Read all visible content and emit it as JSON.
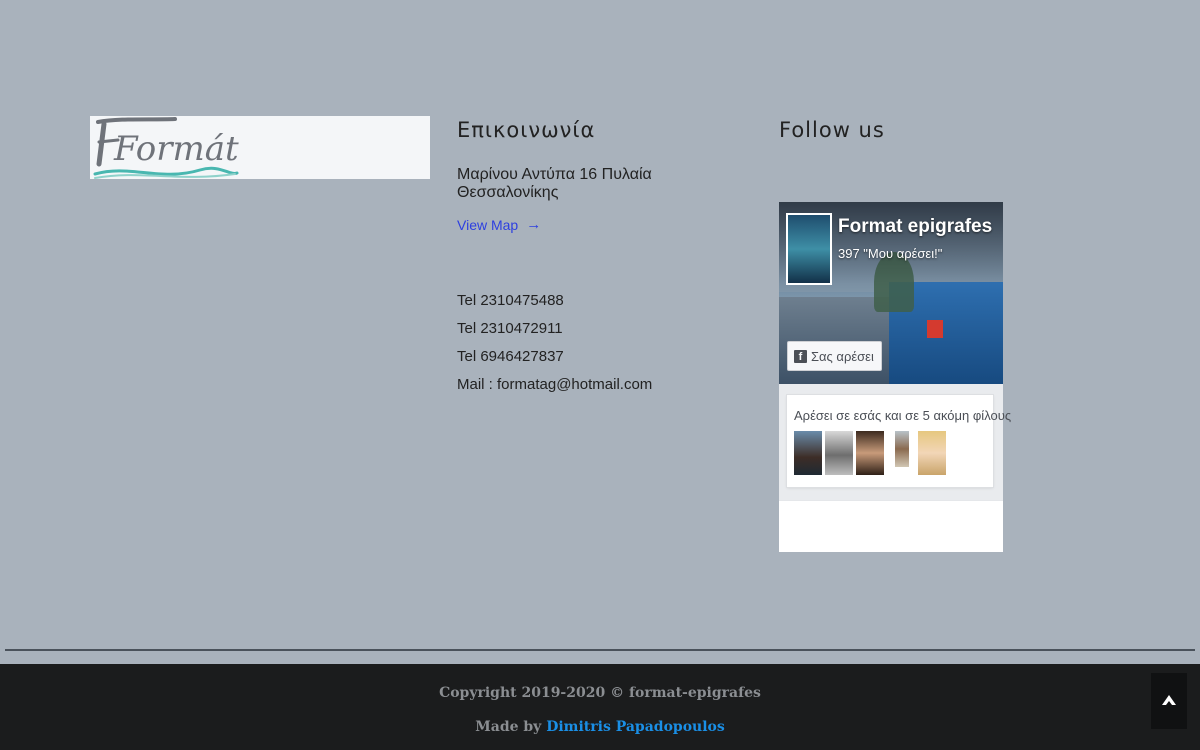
{
  "logo": {
    "text": "Formát",
    "accent_color": "#49b7b0"
  },
  "contact": {
    "title": "Επικοινωνία",
    "address": "Μαρίνου Αντύπα 16 Πυλαία Θεσσαλονίκης",
    "view_map_label": "View Map",
    "view_map_icon": "arrow-right-icon",
    "phones": [
      "Tel 2310475488",
      "Tel 2310472911",
      "Tel 6946427837"
    ],
    "mail": "Mail : formatag@hotmail.com"
  },
  "follow": {
    "title": "Follow us",
    "facebook": {
      "page_name": "Format epigrafes",
      "likes_text": "397 \"Μου αρέσει!\"",
      "like_button_label": "Σας αρέσει",
      "like_button_icon": "facebook-icon",
      "friends_text": "Αρέσει σε εσάς και σε 5 ακόμη φίλους"
    }
  },
  "footer": {
    "copyright": "Copyright 2019-2020 © format-epigrafes",
    "made_by_prefix": "Made by ",
    "made_by_author": "Dimitris Papadopoulos",
    "scroll_top_icon": "chevron-up-icon"
  },
  "colors": {
    "page_background": "#a9b2bc",
    "footer_background": "#1b1c1d",
    "link": "#2d3fe0",
    "author_link": "#1a8fe6"
  }
}
